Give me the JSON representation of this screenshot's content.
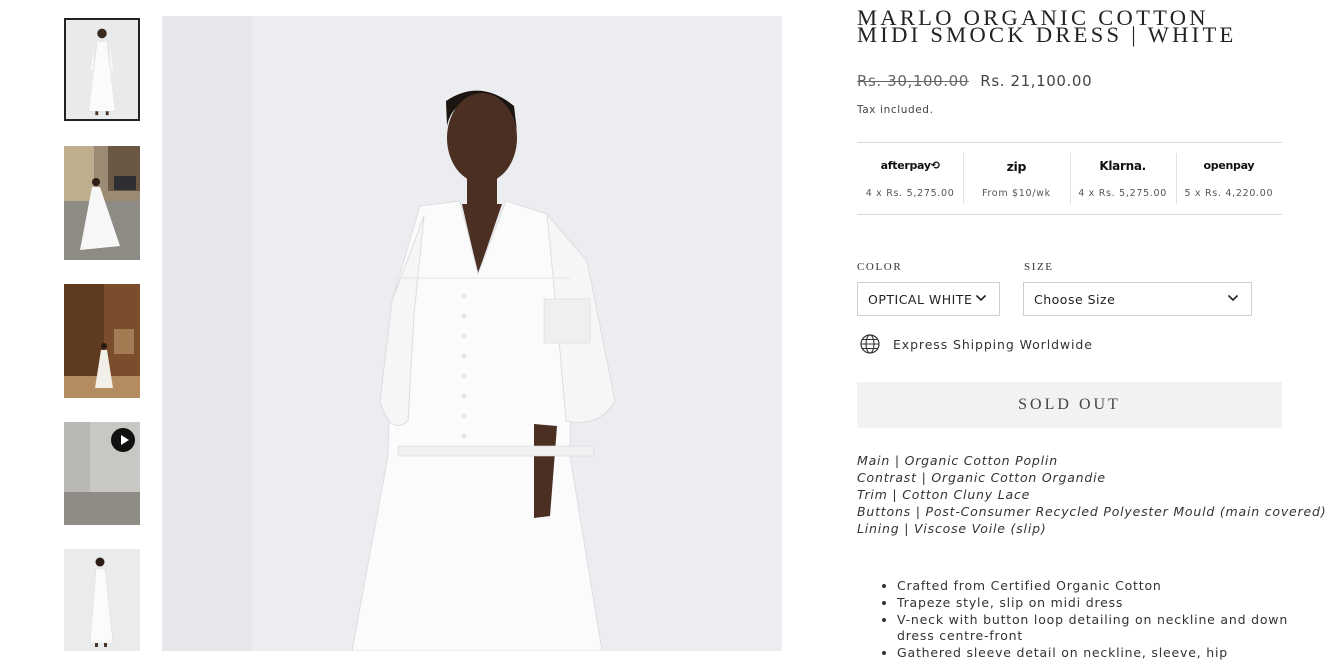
{
  "gallery": {
    "thumbnails": [
      {
        "name": "thumb-front-studio",
        "active": true,
        "video": false
      },
      {
        "name": "thumb-street-twirl",
        "active": false,
        "video": false
      },
      {
        "name": "thumb-walking-sidewalk",
        "active": false,
        "video": false
      },
      {
        "name": "thumb-video",
        "active": false,
        "video": true
      },
      {
        "name": "thumb-side-studio",
        "active": false,
        "video": false
      }
    ]
  },
  "product": {
    "title_line1": "MARLO ORGANIC COTTON",
    "title_line2": "MIDI SMOCK DRESS | WHITE",
    "price_old": "Rs. 30,100.00",
    "price_new": "Rs. 21,100.00",
    "tax_note": "Tax included."
  },
  "payments": [
    {
      "logo": "afterpay⟲",
      "text": "4 x Rs. 5,275.00"
    },
    {
      "logo": "zip",
      "text": "From $10/wk"
    },
    {
      "logo": "Klarna.",
      "text": "4 x Rs. 5,275.00"
    },
    {
      "logo": "openpay",
      "text": "5 x Rs. 4,220.00"
    }
  ],
  "options": {
    "color_label": "COLOR",
    "color_value": "OPTICAL WHITE",
    "size_label": "SIZE",
    "size_value": "Choose Size"
  },
  "shipping": {
    "text": "Express Shipping Worldwide",
    "icon": "globe-icon"
  },
  "buy_button": "SOLD OUT",
  "materials": [
    "Main | Organic Cotton Poplin",
    "Contrast | Organic Cotton Organdie",
    "Trim | Cotton Cluny Lace",
    "Buttons | Post-Consumer Recycled Polyester Mould (main covered)",
    "Lining | Viscose Voile (slip)"
  ],
  "features": [
    "Crafted from Certified Organic Cotton",
    "Trapeze style, slip on midi dress",
    "V-neck with button loop detailing on neckline and down dress centre-front",
    "Gathered sleeve detail on neckline, sleeve, hip"
  ],
  "colors": {
    "text": "#1c1c1c",
    "border": "#dadada",
    "button_bg": "#f2f2f2"
  }
}
